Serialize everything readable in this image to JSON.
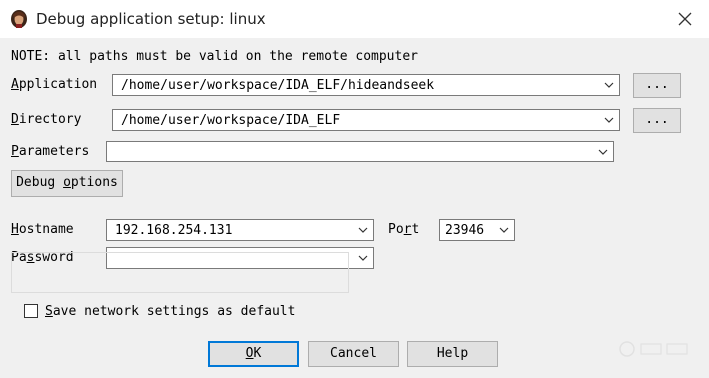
{
  "window": {
    "title": "Debug application setup: linux"
  },
  "note": "NOTE: all paths must be valid on the remote computer",
  "application": {
    "label_prefix": "A",
    "label_rest": "pplication",
    "value": "/home/user/workspace/IDA_ELF/hideandseek",
    "browse_label": "..."
  },
  "directory": {
    "label_prefix": "D",
    "label_rest": "irectory",
    "value": "/home/user/workspace/IDA_ELF",
    "browse_label": "..."
  },
  "parameters": {
    "label_prefix": "P",
    "label_rest": "arameters",
    "value": ""
  },
  "debug_options": {
    "label_before": "Debug ",
    "label_key": "o",
    "label_after": "ptions"
  },
  "hostname": {
    "label_prefix": "H",
    "label_rest": "ostname",
    "value": "192.168.254.131"
  },
  "port": {
    "label_before": "Po",
    "label_key": "r",
    "label_after": "t",
    "value": "23946"
  },
  "password": {
    "label_before": "Pa",
    "label_key": "s",
    "label_after": "sword",
    "value": ""
  },
  "save_default": {
    "label_prefix": "S",
    "label_rest": "ave network settings as default",
    "checked": false
  },
  "buttons": {
    "ok_key": "O",
    "ok_rest": "K",
    "cancel": "Cancel",
    "help": "Help"
  },
  "colors": {
    "focus_border": "#0078d7",
    "dialog_bg": "#f0f0f0",
    "button_bg": "#e1e1e1"
  },
  "icons": {
    "app": "ida-portrait-icon",
    "close": "close-icon",
    "dropdown": "chevron-down-icon"
  }
}
